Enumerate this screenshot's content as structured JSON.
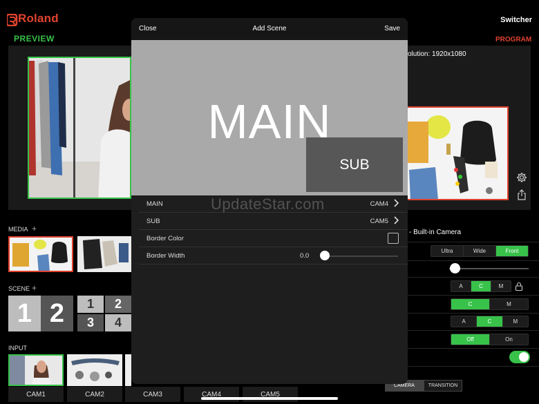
{
  "header": {
    "brand": "Roland",
    "switcher": "Switcher"
  },
  "preview": {
    "label": "PREVIEW"
  },
  "program": {
    "label": "PROGRAM",
    "resolution": "olution: 1920x1080"
  },
  "media": {
    "label": "MEDIA"
  },
  "scene": {
    "label": "SCENE",
    "layout1": [
      "1",
      "2"
    ],
    "layout2": [
      "1",
      "2",
      "3",
      "4"
    ]
  },
  "input": {
    "label": "INPUT",
    "cams": [
      "CAM1",
      "CAM2",
      "CAM3",
      "CAM4",
      "CAM5"
    ]
  },
  "camera_panel": {
    "title": "- Built-in Camera",
    "lens": [
      "Ultra",
      "Wide",
      "Front"
    ],
    "lens_selected": "Front",
    "mode1": [
      "A",
      "C",
      "M"
    ],
    "mode1_selected": "C",
    "mode2": [
      "C",
      "M"
    ],
    "mode2_selected": "C",
    "mode3": [
      "A",
      "C",
      "M"
    ],
    "mode3_selected": "C",
    "onoff": [
      "Off",
      "On"
    ],
    "onoff_selected": "Off",
    "tabs": [
      "CAMERA",
      "TRANSITION"
    ],
    "tab_selected": "CAMERA"
  },
  "modal": {
    "close": "Close",
    "title": "Add Scene",
    "save": "Save",
    "preview_main": "MAIN",
    "preview_sub": "SUB",
    "rows": {
      "main": {
        "label": "MAIN",
        "value": "CAM4"
      },
      "sub": {
        "label": "SUB",
        "value": "CAM5"
      },
      "border_color": {
        "label": "Border Color"
      },
      "border_width": {
        "label": "Border Width",
        "value": "0.0"
      }
    }
  },
  "watermark": "UpdateStar.com",
  "colors": {
    "accent_green": "#38c24a",
    "accent_red": "#e0432f"
  }
}
